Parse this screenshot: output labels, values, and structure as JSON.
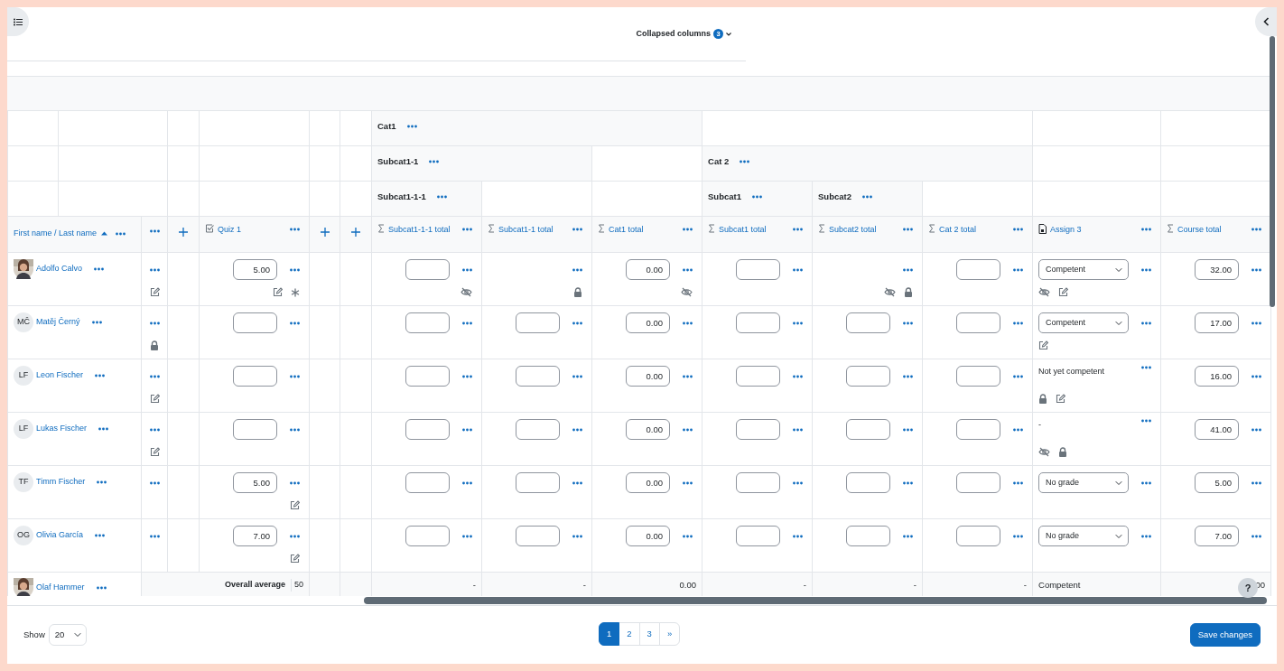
{
  "top_bar": {
    "collapsed_label": "Collapsed columns",
    "collapsed_count": "3"
  },
  "categories": [
    {
      "label": "Cat1",
      "children": [
        {
          "label": "Subcat1-1",
          "children": [
            {
              "label": "Subcat1-1-1"
            }
          ]
        }
      ]
    },
    {
      "label": "Cat 2",
      "children": [
        {
          "label": "Subcat1"
        },
        {
          "label": "Subcat2"
        }
      ]
    }
  ],
  "columns": [
    {
      "kind": "name",
      "label": "First name / Last name"
    },
    {
      "kind": "menu"
    },
    {
      "kind": "add"
    },
    {
      "kind": "quiz",
      "label": "Quiz 1"
    },
    {
      "kind": "add"
    },
    {
      "kind": "add"
    },
    {
      "kind": "total",
      "label": "Subcat1-1-1 total"
    },
    {
      "kind": "total",
      "label": "Subcat1-1 total"
    },
    {
      "kind": "total",
      "label": "Cat1 total"
    },
    {
      "kind": "total",
      "label": "Subcat1 total"
    },
    {
      "kind": "total",
      "label": "Subcat2 total"
    },
    {
      "kind": "total",
      "label": "Cat 2 total"
    },
    {
      "kind": "assign",
      "label": "Assign 3"
    },
    {
      "kind": "total",
      "label": "Course total"
    }
  ],
  "rows": [
    {
      "name": "Adolfo Calvo",
      "avatar": {
        "kind": "picture"
      },
      "cells": [
        {
          "kind": "menu",
          "icons": [
            {
              "kind": "edit"
            }
          ]
        },
        {
          "kind": "empty"
        },
        {
          "kind": "input",
          "value": "5.00",
          "icons": [
            {
              "kind": "edit"
            },
            {
              "kind": "override"
            }
          ]
        },
        {
          "kind": "empty"
        },
        {
          "kind": "empty"
        },
        {
          "kind": "input",
          "icons": [
            {
              "kind": "hidden"
            }
          ]
        },
        {
          "kind": "menu",
          "icons": [
            {
              "kind": "lock"
            }
          ]
        },
        {
          "kind": "input",
          "value": "0.00",
          "icons": [
            {
              "kind": "hidden"
            }
          ]
        },
        {
          "kind": "input"
        },
        {
          "kind": "menu",
          "icons": [
            {
              "kind": "hidden"
            },
            {
              "kind": "lock"
            }
          ]
        },
        {
          "kind": "input"
        },
        {
          "kind": "select",
          "value": "Competent",
          "icons": [
            {
              "kind": "hidden"
            },
            {
              "kind": "edit"
            }
          ]
        },
        {
          "kind": "input",
          "value": "32.00"
        }
      ]
    },
    {
      "name": "Matěj Černý",
      "avatar": {
        "kind": "initials",
        "text": "MČ"
      },
      "cells": [
        {
          "kind": "menu",
          "icons": [
            {
              "kind": "lock"
            }
          ]
        },
        {
          "kind": "empty"
        },
        {
          "kind": "input"
        },
        {
          "kind": "empty"
        },
        {
          "kind": "empty"
        },
        {
          "kind": "input"
        },
        {
          "kind": "input"
        },
        {
          "kind": "input",
          "value": "0.00"
        },
        {
          "kind": "input"
        },
        {
          "kind": "input"
        },
        {
          "kind": "input"
        },
        {
          "kind": "select",
          "value": "Competent",
          "icons": [
            {
              "kind": "edit"
            }
          ]
        },
        {
          "kind": "input",
          "value": "17.00"
        }
      ]
    },
    {
      "name": "Leon Fischer",
      "avatar": {
        "kind": "initials",
        "text": "LF"
      },
      "cells": [
        {
          "kind": "menu",
          "icons": [
            {
              "kind": "edit"
            }
          ]
        },
        {
          "kind": "empty"
        },
        {
          "kind": "input"
        },
        {
          "kind": "empty"
        },
        {
          "kind": "empty"
        },
        {
          "kind": "input"
        },
        {
          "kind": "input"
        },
        {
          "kind": "input",
          "value": "0.00"
        },
        {
          "kind": "input"
        },
        {
          "kind": "input"
        },
        {
          "kind": "input"
        },
        {
          "kind": "text",
          "value": "Not yet competent",
          "icons": [
            {
              "kind": "lock"
            },
            {
              "kind": "edit"
            }
          ]
        },
        {
          "kind": "input",
          "value": "16.00"
        }
      ]
    },
    {
      "name": "Lukas Fischer",
      "avatar": {
        "kind": "initials",
        "text": "LF"
      },
      "cells": [
        {
          "kind": "menu",
          "icons": [
            {
              "kind": "edit"
            }
          ]
        },
        {
          "kind": "empty"
        },
        {
          "kind": "input"
        },
        {
          "kind": "empty"
        },
        {
          "kind": "empty"
        },
        {
          "kind": "input"
        },
        {
          "kind": "input"
        },
        {
          "kind": "input",
          "value": "0.00"
        },
        {
          "kind": "input"
        },
        {
          "kind": "input"
        },
        {
          "kind": "input"
        },
        {
          "kind": "text",
          "value": "-",
          "icons": [
            {
              "kind": "hidden"
            },
            {
              "kind": "lock"
            }
          ]
        },
        {
          "kind": "input",
          "value": "41.00"
        }
      ]
    },
    {
      "name": "Timm Fischer",
      "avatar": {
        "kind": "initials",
        "text": "TF"
      },
      "cells": [
        {
          "kind": "menu"
        },
        {
          "kind": "empty"
        },
        {
          "kind": "input",
          "value": "5.00",
          "icons": [
            {
              "kind": "edit"
            }
          ]
        },
        {
          "kind": "empty"
        },
        {
          "kind": "empty"
        },
        {
          "kind": "input"
        },
        {
          "kind": "input"
        },
        {
          "kind": "input",
          "value": "0.00"
        },
        {
          "kind": "input"
        },
        {
          "kind": "input"
        },
        {
          "kind": "input"
        },
        {
          "kind": "select",
          "value": "No grade"
        },
        {
          "kind": "input",
          "value": "5.00"
        }
      ]
    },
    {
      "name": "Olivia García",
      "avatar": {
        "kind": "initials",
        "text": "OG"
      },
      "cells": [
        {
          "kind": "menu"
        },
        {
          "kind": "empty"
        },
        {
          "kind": "input",
          "value": "7.00",
          "icons": [
            {
              "kind": "edit"
            }
          ]
        },
        {
          "kind": "empty"
        },
        {
          "kind": "empty"
        },
        {
          "kind": "input"
        },
        {
          "kind": "input"
        },
        {
          "kind": "input",
          "value": "0.00"
        },
        {
          "kind": "input"
        },
        {
          "kind": "input"
        },
        {
          "kind": "input"
        },
        {
          "kind": "select",
          "value": "No grade"
        },
        {
          "kind": "input",
          "value": "7.00"
        }
      ]
    }
  ],
  "last_row": {
    "name": "Olaf Hammer",
    "avatar": {
      "kind": "picture"
    }
  },
  "average": {
    "label": "Overall average",
    "quiz": "50",
    "values": [
      "-",
      "-",
      "0.00",
      "-",
      "-",
      "-",
      "Competent",
      "00"
    ]
  },
  "help_button": "?",
  "footer": {
    "show_label": "Show",
    "per_page": "20",
    "pages": [
      {
        "label": "1",
        "selected": true
      },
      {
        "label": "2",
        "selected": false
      },
      {
        "label": "3",
        "selected": false
      },
      {
        "label": "»",
        "selected": false
      }
    ],
    "save_button": "Save changes"
  }
}
